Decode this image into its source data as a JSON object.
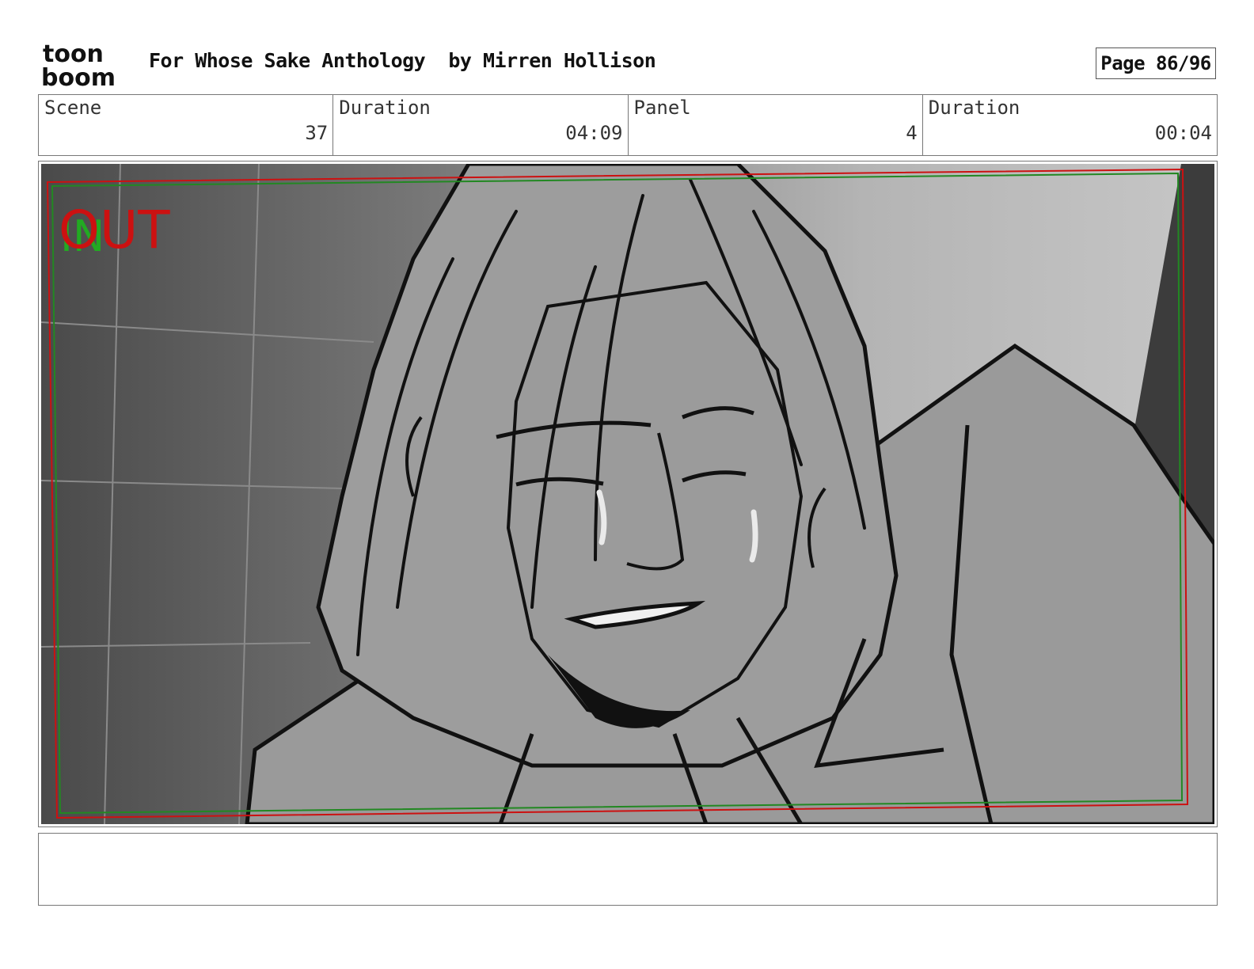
{
  "header": {
    "logo_text_top": "toon",
    "logo_text_bottom": "boom",
    "title": "For Whose Sake Anthology  by Mirren Hollison",
    "page_label": "Page 86/96"
  },
  "info": {
    "scene_label": "Scene",
    "scene_value": "37",
    "scene_duration_label": "Duration",
    "scene_duration_value": "04:09",
    "panel_label": "Panel",
    "panel_value": "4",
    "panel_duration_label": "Duration",
    "panel_duration_value": "00:04"
  },
  "panel": {
    "in_label": "IN",
    "out_label": "OUT",
    "in_color": "#22aa22",
    "out_color": "#cc1111"
  },
  "notes": {
    "text": ""
  }
}
